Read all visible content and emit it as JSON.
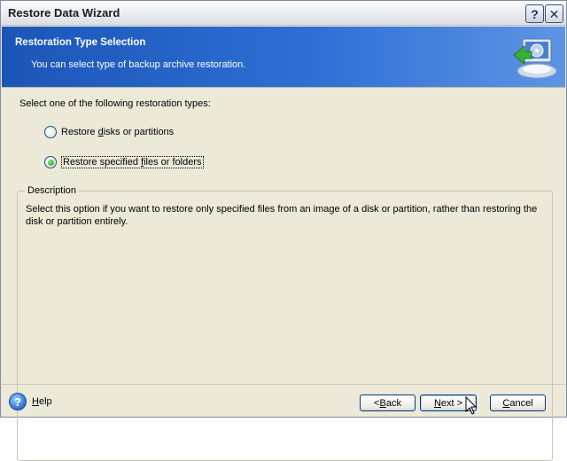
{
  "window": {
    "title": "Restore Data Wizard"
  },
  "header": {
    "title": "Restoration Type Selection",
    "subtitle": "You can select type of backup archive restoration."
  },
  "content": {
    "prompt": "Select one of the following restoration types:",
    "options": [
      {
        "pre": "Restore ",
        "accel": "d",
        "post": "isks or partitions",
        "selected": false
      },
      {
        "pre": "Restore specified ",
        "accel": "f",
        "post": "iles or folders",
        "selected": true
      }
    ],
    "description": {
      "caption": "Description",
      "text": "Select this option if you want to restore only specified files from an image of a disk or partition, rather than restoring the disk or partition entirely."
    }
  },
  "footer": {
    "help_accel": "H",
    "help_rest": "elp",
    "back_pre": "< ",
    "back_accel": "B",
    "back_rest": "ack",
    "next_accel": "N",
    "next_rest": "ext >",
    "cancel_accel": "C",
    "cancel_rest": "ancel"
  },
  "title_buttons": {
    "help": "?",
    "close": "✕"
  },
  "icons": [
    "help-titlebar-icon",
    "close-icon",
    "wizard-restore-icon",
    "help-icon",
    "mouse-cursor-icon"
  ],
  "colors": {
    "header_blue": "#2e6fd4",
    "dialog_bg": "#ece9d8",
    "radio_selected": "#21a121"
  }
}
